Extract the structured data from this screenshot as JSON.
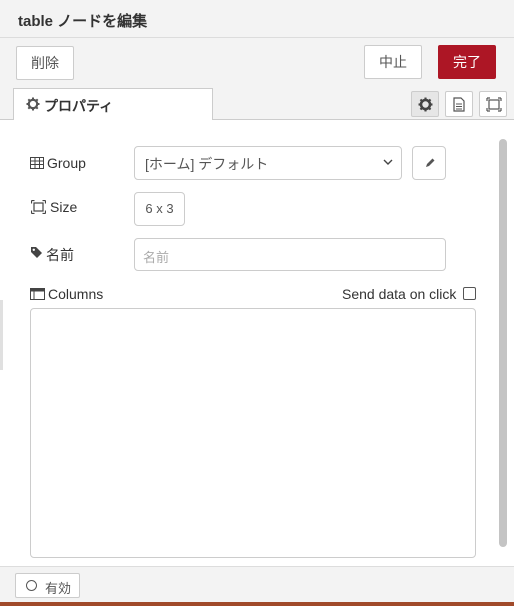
{
  "header": {
    "title": "table ノードを編集"
  },
  "toolbar": {
    "delete_label": "削除",
    "cancel_label": "中止",
    "done_label": "完了"
  },
  "tabs": {
    "properties_label": "プロパティ",
    "icons": [
      "gear-icon",
      "description-icon",
      "appearance-icon"
    ]
  },
  "form": {
    "group": {
      "label": "Group",
      "value": "[ホーム] デフォルト"
    },
    "size": {
      "label": "Size",
      "value": "6 x 3"
    },
    "name": {
      "label": "名前",
      "placeholder": "名前",
      "value": ""
    },
    "columns": {
      "label": "Columns"
    },
    "send_data": {
      "label": "Send data on click",
      "checked": false
    }
  },
  "footer": {
    "enable_label": "有効"
  },
  "colors": {
    "primary": "#ad1625",
    "header_bg": "#f3f3f3"
  }
}
